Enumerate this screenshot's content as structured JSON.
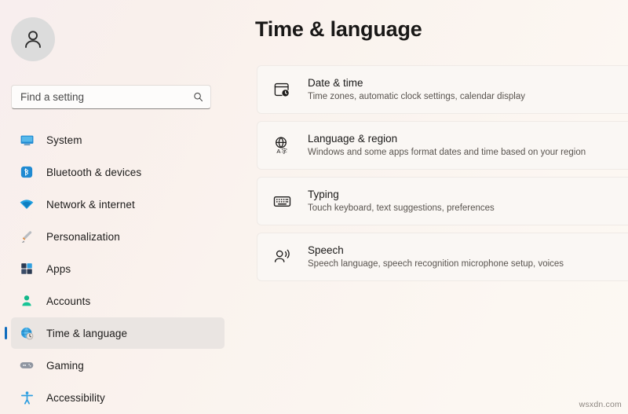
{
  "account": {
    "avatar_icon": "person-avatar-icon"
  },
  "search": {
    "placeholder": "Find a setting",
    "value": "",
    "icon": "search-icon"
  },
  "sidebar": {
    "items": [
      {
        "label": "System",
        "icon": "monitor-icon",
        "selected": false
      },
      {
        "label": "Bluetooth & devices",
        "icon": "bluetooth-icon",
        "selected": false
      },
      {
        "label": "Network & internet",
        "icon": "wifi-icon",
        "selected": false
      },
      {
        "label": "Personalization",
        "icon": "paintbrush-icon",
        "selected": false
      },
      {
        "label": "Apps",
        "icon": "apps-grid-icon",
        "selected": false
      },
      {
        "label": "Accounts",
        "icon": "person-icon",
        "selected": false
      },
      {
        "label": "Time & language",
        "icon": "globe-clock-icon",
        "selected": true
      },
      {
        "label": "Gaming",
        "icon": "gamepad-icon",
        "selected": false
      },
      {
        "label": "Accessibility",
        "icon": "accessibility-icon",
        "selected": false
      }
    ]
  },
  "main": {
    "title": "Time & language",
    "cards": [
      {
        "title": "Date & time",
        "subtitle": "Time zones, automatic clock settings, calendar display",
        "icon": "calendar-clock-icon"
      },
      {
        "title": "Language & region",
        "subtitle": "Windows and some apps format dates and time based on your region",
        "icon": "globe-language-icon"
      },
      {
        "title": "Typing",
        "subtitle": "Touch keyboard, text suggestions, preferences",
        "icon": "keyboard-icon"
      },
      {
        "title": "Speech",
        "subtitle": "Speech language, speech recognition microphone setup, voices",
        "icon": "speech-person-icon"
      }
    ]
  },
  "watermark": {
    "text": "wsxdn.com"
  },
  "colors": {
    "accent": "#0f6cbd",
    "selected_row": "#eae5e2",
    "card_bg": "#faf7f4",
    "text_primary": "#1a1918",
    "text_secondary": "#59544f"
  }
}
